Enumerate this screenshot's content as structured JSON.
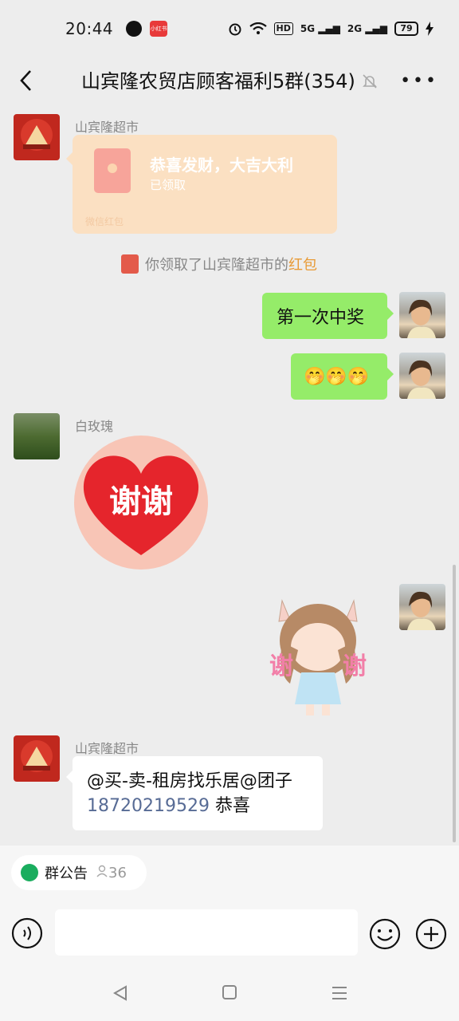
{
  "status_bar": {
    "time": "20:44",
    "app_icon_2_label": "小红书",
    "hd": "HD",
    "net_5g": "5G",
    "net_2g": "2G",
    "battery": "79"
  },
  "header": {
    "title": "山宾隆农贸店顾客福利5群(354)",
    "more": "•••"
  },
  "messages": {
    "red_packet": {
      "sender": "山宾隆超市",
      "title": "恭喜发财，大吉大利",
      "status": "已领取",
      "footer": "微信红包"
    },
    "system": {
      "text": "你领取了山宾隆超市的",
      "link": "红包"
    },
    "self_1": {
      "text": "第一次中奖"
    },
    "self_2": {
      "text": "🤭🤭🤭"
    },
    "rose": {
      "sender": "白玫瑰",
      "sticker_text": "谢谢"
    },
    "self_3": {
      "sticker_text_left": "谢",
      "sticker_text_right": "谢"
    },
    "shop_text": {
      "sender": "山宾隆超市",
      "line1": "@买-卖-租房找乐居@团子",
      "phone": "18720219529",
      "tail": "恭喜"
    }
  },
  "bottom": {
    "notice_label": "群公告",
    "member_count": "36"
  },
  "colors": {
    "green_bubble": "#95ec69",
    "red_packet": "#fbe0c2",
    "link_orange": "#e89a36",
    "phone_link": "#576b95"
  }
}
